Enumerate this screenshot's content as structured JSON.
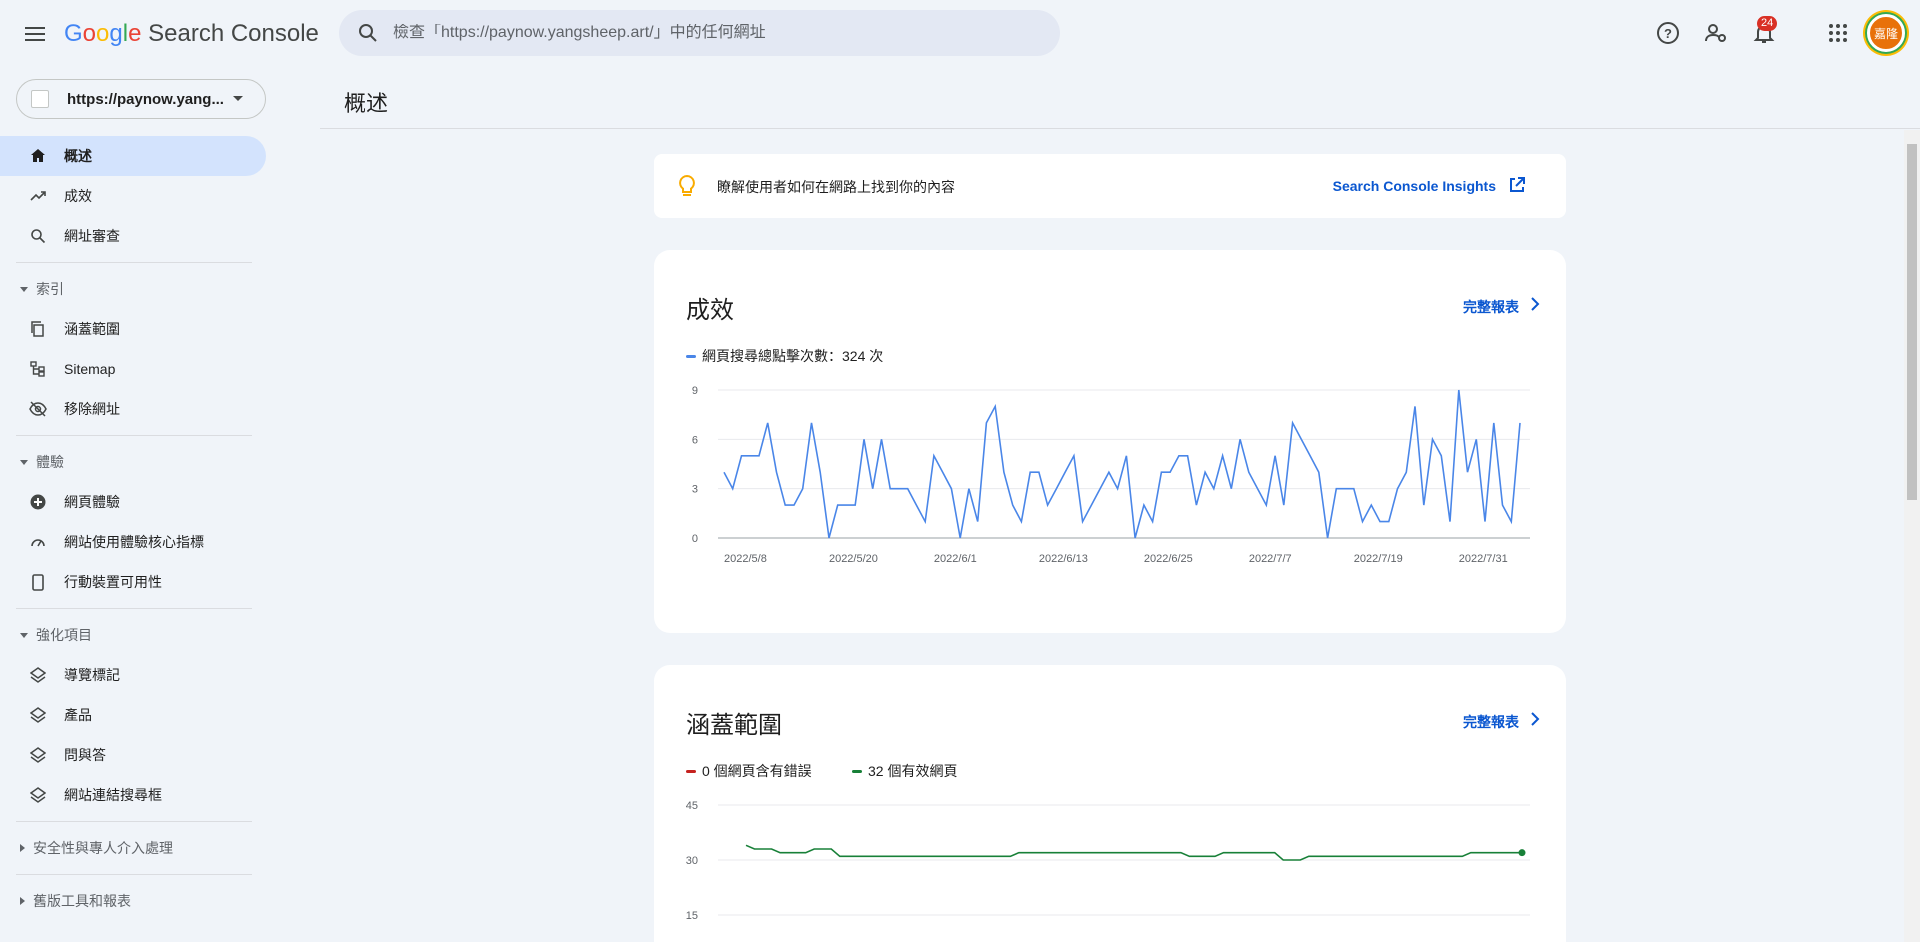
{
  "header": {
    "logo": {
      "G": "G",
      "o1": "o",
      "o2": "o",
      "g": "g",
      "l": "l",
      "e": "e",
      "rest": " Search Console"
    },
    "search_placeholder": "檢查「https://paynow.yangsheep.art/」中的任何網址",
    "notification_count": "24",
    "avatar_text": "嘉隆",
    "icons": [
      "menu-icon",
      "search-icon",
      "help-icon",
      "manage-users-icon",
      "notifications-icon",
      "apps-icon"
    ]
  },
  "sidebar": {
    "property_label": "https://paynow.yang...",
    "items_top": [
      {
        "label": "概述",
        "icon": "home-icon",
        "active": true
      },
      {
        "label": "成效",
        "icon": "trending-icon"
      },
      {
        "label": "網址審查",
        "icon": "search-icon"
      }
    ],
    "section_index": {
      "label": "索引"
    },
    "items_index": [
      {
        "label": "涵蓋範圍",
        "icon": "coverage-icon"
      },
      {
        "label": "Sitemap",
        "icon": "sitemap-icon"
      },
      {
        "label": "移除網址",
        "icon": "removal-icon"
      }
    ],
    "section_experience": {
      "label": "體驗"
    },
    "items_experience": [
      {
        "label": "網頁體驗",
        "icon": "page-experience-icon"
      },
      {
        "label": "網站使用體驗核心指標",
        "icon": "speedometer-icon"
      },
      {
        "label": "行動裝置可用性",
        "icon": "mobile-icon"
      }
    ],
    "section_enhancements": {
      "label": "強化項目"
    },
    "items_enhancements": [
      {
        "label": "導覽標記",
        "icon": "layers-icon"
      },
      {
        "label": "產品",
        "icon": "layers-icon"
      },
      {
        "label": "問與答",
        "icon": "layers-icon"
      },
      {
        "label": "網站連結搜尋框",
        "icon": "layers-icon"
      }
    ],
    "section_security": {
      "label": "安全性與專人介入處理"
    },
    "section_legacy": {
      "label": "舊版工具和報表"
    }
  },
  "main": {
    "page_title": "概述",
    "insights": {
      "text": "瞭解使用者如何在網路上找到你的內容",
      "link": "Search Console Insights"
    },
    "performance": {
      "title": "成效",
      "full_report": "完整報表",
      "legend": "網頁搜尋總點擊次數：324 次",
      "color": "#4a86e8"
    },
    "coverage": {
      "title": "涵蓋範圍",
      "full_report": "完整報表",
      "legend_errors": "0 個網頁含有錯誤",
      "legend_valid": "32 個有效網頁",
      "error_color": "#c5221f",
      "valid_color": "#188038"
    }
  },
  "chart_data": [
    {
      "type": "line",
      "title": "成效",
      "series": [
        {
          "name": "網頁搜尋總點擊次數：324 次",
          "values": [
            4,
            3,
            5,
            5,
            5,
            7,
            4,
            2,
            2,
            3,
            7,
            4,
            0,
            2,
            2,
            2,
            6,
            3,
            6,
            3,
            3,
            3,
            2,
            1,
            5,
            4,
            3,
            0,
            3,
            1,
            7,
            8,
            4,
            2,
            1,
            4,
            4,
            2,
            3,
            4,
            5,
            1,
            2,
            3,
            4,
            3,
            5,
            0,
            2,
            1,
            4,
            4,
            5,
            5,
            2,
            4,
            3,
            5,
            3,
            6,
            4,
            3,
            2,
            5,
            2,
            7,
            6,
            5,
            4,
            0,
            3,
            3,
            3,
            1,
            2,
            1,
            1,
            3,
            4,
            8,
            2,
            6,
            5,
            1,
            9,
            4,
            6,
            1,
            7,
            2,
            1,
            7
          ]
        }
      ],
      "x_tick_labels": [
        "2022/5/8",
        "2022/5/20",
        "2022/6/1",
        "2022/6/13",
        "2022/6/25",
        "2022/7/7",
        "2022/7/19",
        "2022/7/31"
      ],
      "x_tick_indices": [
        0,
        12,
        24,
        36,
        48,
        60,
        72,
        84
      ],
      "y_ticks": [
        0,
        3,
        6,
        9
      ],
      "ylim": [
        0,
        9
      ],
      "grid": true
    },
    {
      "type": "line",
      "title": "涵蓋範圍",
      "series": [
        {
          "name": "32 個有效網頁",
          "values": [
            34,
            33,
            33,
            33,
            32,
            32,
            32,
            32,
            33,
            33,
            33,
            31,
            31,
            31,
            31,
            31,
            31,
            31,
            31,
            31,
            31,
            31,
            31,
            31,
            31,
            31,
            31,
            31,
            31,
            31,
            31,
            31,
            32,
            32,
            32,
            32,
            32,
            32,
            32,
            32,
            32,
            32,
            32,
            32,
            32,
            32,
            32,
            32,
            32,
            32,
            32,
            32,
            31,
            31,
            31,
            31,
            32,
            32,
            32,
            32,
            32,
            32,
            32,
            30,
            30,
            30,
            31,
            31,
            31,
            31,
            31,
            31,
            31,
            31,
            31,
            31,
            31,
            31,
            31,
            31,
            31,
            31,
            31,
            31,
            31,
            32,
            32,
            32,
            32,
            32,
            32,
            32
          ]
        },
        {
          "name": "0 個網頁含有錯誤",
          "values": [
            0
          ]
        }
      ],
      "y_ticks": [
        15,
        30,
        45
      ],
      "ylim": [
        0,
        45
      ],
      "grid": true
    }
  ]
}
